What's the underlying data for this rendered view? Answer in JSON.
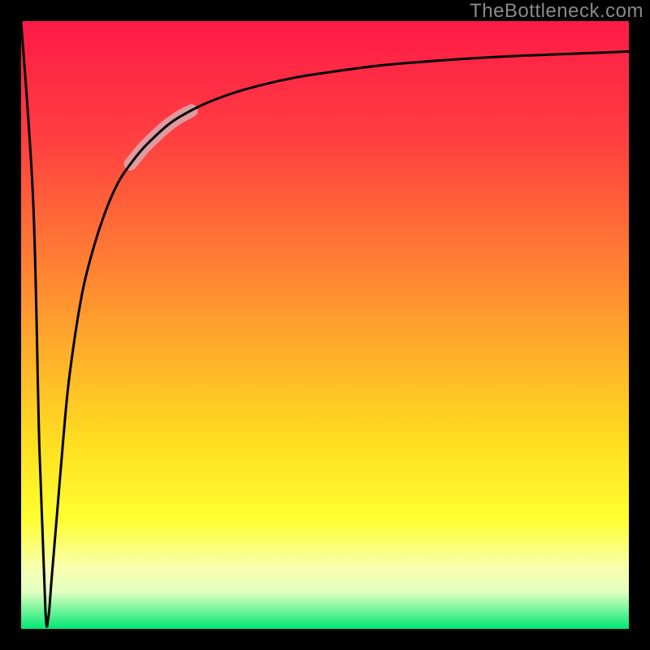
{
  "watermark": "TheBottleneck.com",
  "colors": {
    "background": "#000000",
    "gradient_stops": [
      {
        "offset": 0.0,
        "color": "#ff1a48"
      },
      {
        "offset": 0.2,
        "color": "#ff4040"
      },
      {
        "offset": 0.45,
        "color": "#ff9030"
      },
      {
        "offset": 0.7,
        "color": "#ffe020"
      },
      {
        "offset": 0.82,
        "color": "#ffff30"
      },
      {
        "offset": 0.9,
        "color": "#f8ffb0"
      },
      {
        "offset": 0.94,
        "color": "#e0ffc0"
      },
      {
        "offset": 1.0,
        "color": "#00e874"
      }
    ],
    "curve": "#000000",
    "highlight": "#d9aab0"
  },
  "chart_data": {
    "type": "line",
    "title": "",
    "xlabel": "",
    "ylabel": "",
    "xlim": [
      0,
      100
    ],
    "ylim": [
      0,
      100
    ],
    "x": [
      0,
      2,
      3,
      4,
      4.5,
      5,
      6,
      7,
      8,
      10,
      12,
      14,
      16,
      18,
      20,
      22,
      24,
      26,
      30,
      35,
      40,
      45,
      50,
      55,
      60,
      70,
      80,
      90,
      100
    ],
    "values": [
      100,
      70,
      30,
      3,
      2,
      8,
      20,
      32,
      42,
      55,
      63,
      69,
      73.5,
      76.5,
      79,
      81,
      82.8,
      84.2,
      86.3,
      88.2,
      89.6,
      90.7,
      91.5,
      92.2,
      92.8,
      93.6,
      94.2,
      94.6,
      95
    ],
    "highlight_segment": {
      "x_start": 18,
      "x_end": 28
    },
    "grid": false,
    "legend": false
  }
}
